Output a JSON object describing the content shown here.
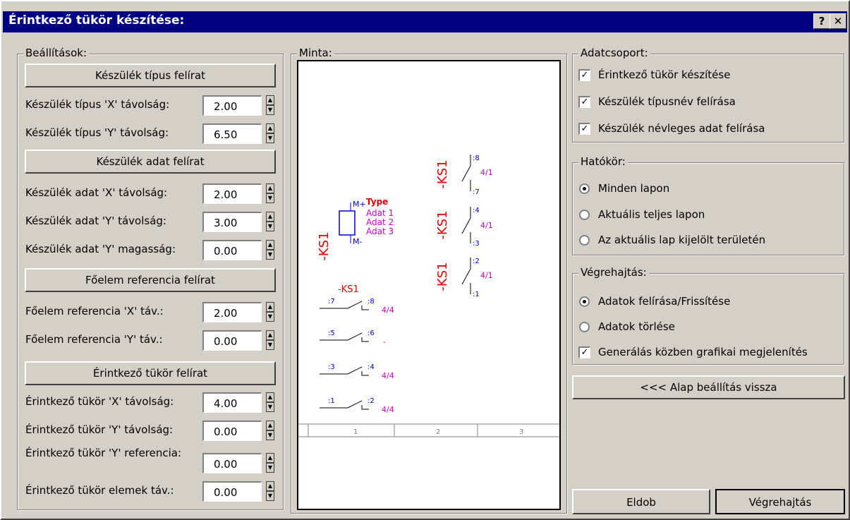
{
  "dialog": {
    "title": "Érintkező tükör készítése:",
    "help_label": "?",
    "close_label": "✕"
  },
  "settings": {
    "legend": "Beállítások:",
    "type_header": "Készülék típus felírat",
    "type_x_label": "Készülék típus 'X' távolság:",
    "type_x_value": "2.00",
    "type_y_label": "Készülék típus 'Y' távolság:",
    "type_y_value": "6.50",
    "data_header": "Készülék adat felírat",
    "data_x_label": "Készülék adat 'X' távolság:",
    "data_x_value": "2.00",
    "data_y_label": "Készülék adat 'Y' távolság:",
    "data_y_value": "3.00",
    "data_h_label": "Készülék adat 'Y' magasság:",
    "data_h_value": "0.00",
    "ref_header": "Főelem referencia felírat",
    "ref_x_label": "Főelem referencia 'X' táv.:",
    "ref_x_value": "2.00",
    "ref_y_label": "Főelem referencia 'Y' táv.:",
    "ref_y_value": "0.00",
    "mirror_header": "Érintkező tükör felírat",
    "mirror_x_label": "Érintkező tükör 'X' távolság:",
    "mirror_x_value": "4.00",
    "mirror_y_label": "Érintkező tükör 'Y' távolság:",
    "mirror_y_value": "0.00",
    "mirror_ref_label": "Érintkező tükör 'Y' referencia:",
    "mirror_ref_value": "0.00",
    "mirror_elem_label": "Érintkező tükör elemek táv.:",
    "mirror_elem_value": "0.00"
  },
  "sample": {
    "legend": "Minta:",
    "type_label": "Type",
    "adat1": "Adat 1",
    "adat2": "Adat 2",
    "adat3": "Adat 3",
    "device": "-KS1",
    "mplus": "M+",
    "mminus": "M-",
    "c8": ":8",
    "c7": ":7",
    "c4": ":4",
    "c3": ":3",
    "c2": ":2",
    "c1": ":1",
    "c5": ":5",
    "c6": ":6",
    "ref41": "4/1",
    "ref44": "4/4",
    "dash": "-",
    "col1": "1",
    "col2": "2",
    "col3": "3"
  },
  "datagroup": {
    "legend": "Adatcsoport:",
    "items": [
      {
        "label": "Érintkező tükör készítése",
        "checked": true
      },
      {
        "label": "Készülék típusnév felírása",
        "checked": true
      },
      {
        "label": "Készülék névleges adat felírása",
        "checked": true
      }
    ]
  },
  "scope": {
    "legend": "Hatókör:",
    "items": [
      {
        "label": "Minden lapon",
        "selected": true
      },
      {
        "label": "Aktuális teljes lapon",
        "selected": false
      },
      {
        "label": "Az aktuális lap kijelölt területén",
        "selected": false
      }
    ]
  },
  "exec": {
    "legend": "Végrehajtás:",
    "opt1": "Adatok felírása/Frissítése",
    "opt2": "Adatok törlése",
    "graphic": "Generálás közben grafikai megjelenítés",
    "check_mark": "✓"
  },
  "buttons": {
    "reset": "<<< Alap beállítás vissza",
    "cancel": "Eldob",
    "execute": "Végrehajtás"
  },
  "colors": {
    "red": "#e00000",
    "blue": "#0000cc",
    "magenta": "#cc00cc"
  }
}
